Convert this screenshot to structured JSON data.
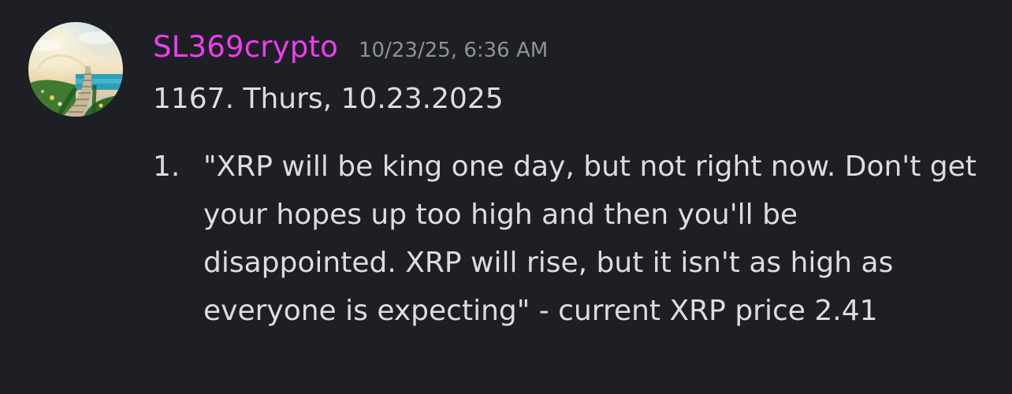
{
  "message": {
    "author": {
      "name": "SL369crypto",
      "color": "#f03cf0",
      "avatar_icon": "stairway-to-heaven-avatar"
    },
    "timestamp": "10/23/25, 6:36 AM",
    "headline": "1167.  Thurs, 10.23.2025",
    "list": [
      {
        "marker": "1.",
        "text": "\"XRP will be king one day, but not right now. Don't get your hopes up too high and then you'll be disappointed. XRP will rise, but it isn't as high as everyone is expecting\" - current XRP price 2.41"
      }
    ]
  },
  "colors": {
    "background": "#1e1f24",
    "text": "#dcdde1",
    "muted": "#8f919a"
  }
}
